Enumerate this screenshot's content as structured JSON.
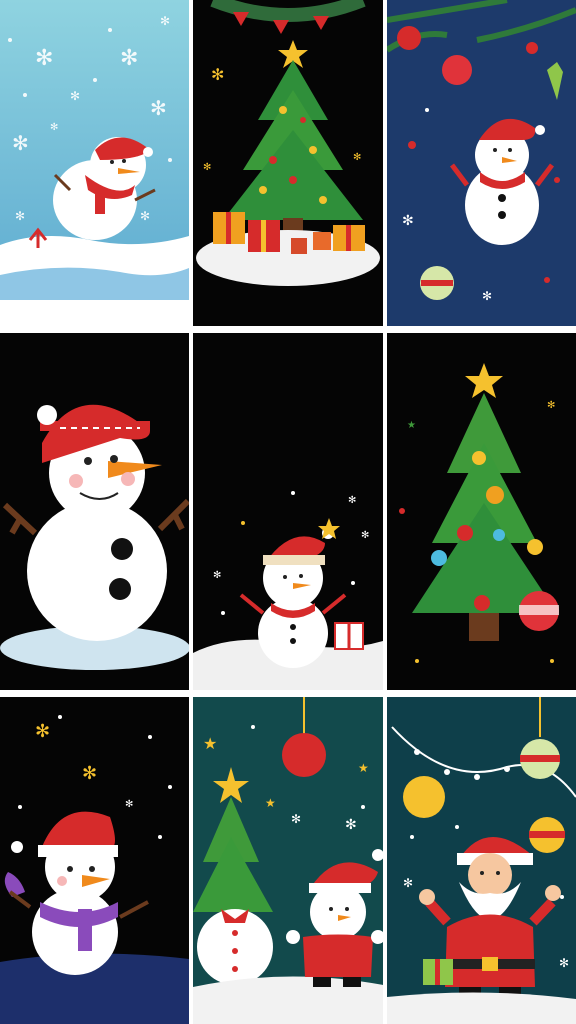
{
  "grid": {
    "rows": 3,
    "columns": 3
  },
  "colors": {
    "gutter": "#ffffff",
    "bg_light_blue": "#7cc1d6",
    "bg_black": "#050505",
    "bg_navy": "#1d3a6b",
    "bg_teal": "#124a4c",
    "bg_dark_teal": "#0e3f4a",
    "santa_red": "#d62b2b",
    "tree_green": "#3f9a3a",
    "star_gold": "#f5c12e",
    "snow_white": "#ffffff"
  },
  "panels": [
    {
      "row": 1,
      "col": 1,
      "subject": "snowman with red hat and scarf on snowy ground, blue snowy sky",
      "background": "light-blue"
    },
    {
      "row": 1,
      "col": 2,
      "subject": "decorated christmas tree with star and presents, bunting garland",
      "background": "black"
    },
    {
      "row": 1,
      "col": 3,
      "subject": "snowman waving with pine branches and ornaments",
      "background": "navy"
    },
    {
      "row": 2,
      "col": 1,
      "subject": "large smiling snowman with red hat and stick arms",
      "background": "black"
    },
    {
      "row": 2,
      "col": 2,
      "subject": "small snowman in santa hat with gift on snow",
      "background": "black"
    },
    {
      "row": 2,
      "col": 3,
      "subject": "christmas tree with star and ornaments",
      "background": "black"
    },
    {
      "row": 3,
      "col": 1,
      "subject": "snowman with purple scarf and mitten under starry sky",
      "background": "black"
    },
    {
      "row": 3,
      "col": 2,
      "subject": "christmas tree, snowman and snowman in red coat with hanging ornament",
      "background": "teal"
    },
    {
      "row": 3,
      "col": 3,
      "subject": "santa claus waving with string lights, ornaments and gift",
      "background": "dark-teal"
    }
  ]
}
